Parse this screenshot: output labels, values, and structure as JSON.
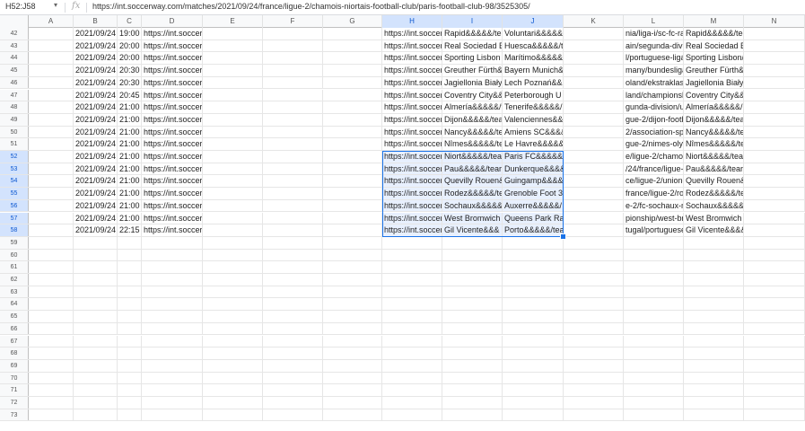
{
  "formula_bar": {
    "name_box": "H52:J58",
    "fx": "fx",
    "formula": "https://int.soccerway.com/matches/2021/09/24/france/ligue-2/chamois-niortais-football-club/paris-football-club-98/3525305/"
  },
  "columns": [
    "A",
    "B",
    "C",
    "D",
    "E",
    "F",
    "G",
    "H",
    "I",
    "J",
    "K",
    "L",
    "M",
    "N"
  ],
  "selected_columns": [
    "H",
    "I",
    "J"
  ],
  "selected_rows": [
    52,
    53,
    54,
    55,
    56,
    57,
    58
  ],
  "rows": [
    {
      "n": 42,
      "B": "2021/09/24",
      "C": "19:00",
      "D": "https://int.soccer",
      "H": "https://int.soccer",
      "I": "Rapid&&&&&/te",
      "J": "Voluntari&&&&&",
      "L": "nia/liga-i/sc-fc-rap",
      "M": "Rapid&&&&&/teomania/cs-fc-petr"
    },
    {
      "n": 43,
      "B": "2021/09/24",
      "C": "20:00",
      "D": "https://int.soccer",
      "H": "https://int.soccer",
      "I": "Real Sociedad E",
      "J": "Huesca&&&&&/t",
      "L": "ain/segunda-divis",
      "M": "Real Sociedad E/teams/spain/sd"
    },
    {
      "n": 44,
      "B": "2021/09/24",
      "C": "20:00",
      "D": "https://int.soccer",
      "H": "https://int.soccer",
      "I": "Sporting Lisbon",
      "J": "Marítimo&&&&&",
      "L": "l/portuguese-liga",
      "M": "Sporting Lisbon/ams/portugal/ma"
    },
    {
      "n": 45,
      "B": "2021/09/24",
      "C": "20:30",
      "D": "https://int.soccer",
      "H": "https://int.soccer",
      "I": "Greuther Fürth&",
      "J": "Bayern Munich&",
      "L": "many/bundesliga",
      "M": "Greuther Fürth&/teams/germany/f"
    },
    {
      "n": 46,
      "B": "2021/09/24",
      "C": "20:30",
      "D": "https://int.soccer",
      "H": "https://int.soccer",
      "I": "Jagiellonia Biały",
      "J": "Lech Poznań&&",
      "L": "oland/ekstraklas",
      "M": "Jagiellonia Biały/teams/poland/k"
    },
    {
      "n": 47,
      "B": "2021/09/24",
      "C": "20:45",
      "D": "https://int.soccer",
      "H": "https://int.soccer",
      "I": "Coventry City&&",
      "J": "Peterborough U",
      "L": "land/championsh",
      "M": "Coventry City&&/teams/england/"
    },
    {
      "n": 48,
      "B": "2021/09/24",
      "C": "21:00",
      "D": "https://int.soccer",
      "H": "https://int.soccer",
      "I": "Almería&&&&&/t",
      "J": "Tenerife&&&&&/",
      "L": "gunda-division/u",
      "M": "Almería&&&&&/ns/spain/club-dep"
    },
    {
      "n": 49,
      "B": "2021/09/24",
      "C": "21:00",
      "D": "https://int.soccer",
      "H": "https://int.soccer",
      "I": "Dijon&&&&&/tea",
      "J": "Valenciennes&&",
      "L": "gue-2/dijon-footb",
      "M": "Dijon&&&&&/tea/france/valencien"
    },
    {
      "n": 50,
      "B": "2021/09/24",
      "C": "21:00",
      "D": "https://int.soccer",
      "H": "https://int.soccer",
      "I": "Nancy&&&&&/te",
      "J": "Amiens SC&&&&",
      "L": "2/association-spc",
      "M": "Nancy&&&&&/te/france/amiens-s"
    },
    {
      "n": 51,
      "B": "2021/09/24",
      "C": "21:00",
      "D": "https://int.soccer",
      "H": "https://int.soccer",
      "I": "Nîmes&&&&&/te",
      "J": "Le Havre&&&&&",
      "L": "gue-2/nimes-olyn",
      "M": "Nîmes&&&&&/te/e/le-havre-athlet"
    },
    {
      "n": 52,
      "B": "2021/09/24",
      "C": "21:00",
      "D": "https://int.soccer",
      "H": "https://int.soccer",
      "I": "Niort&&&&&/tea",
      "J": "Paris FC&&&&&",
      "L": "e/ligue-2/chamois",
      "M": "Niort&&&&&/teams/france/paris-fc"
    },
    {
      "n": 53,
      "B": "2021/09/24",
      "C": "21:00",
      "D": "https://int.soccer",
      "H": "https://int.soccer",
      "I": "Pau&&&&&/tear",
      "J": "Dunkerque&&&&",
      "L": "/24/france/ligue-2",
      "M": "Pau&&&&&/tear/teams/france/us"
    },
    {
      "n": 54,
      "B": "2021/09/24",
      "C": "21:00",
      "D": "https://int.soccer",
      "H": "https://int.soccer",
      "I": "Quevilly Rouen&",
      "J": "Guingamp&&&&",
      "L": "ce/ligue-2/union-s",
      "M": "Quevilly Rouen&ms/france/en-ava"
    },
    {
      "n": 55,
      "B": "2021/09/24",
      "C": "21:00",
      "D": "https://int.soccer",
      "H": "https://int.soccer",
      "I": "Rodez&&&&&/te",
      "J": "Grenoble Foot 3",
      "L": "france/ligue-2/roc",
      "M": "Rodez&&&&&/te&/teams/france"
    },
    {
      "n": 56,
      "B": "2021/09/24",
      "C": "21:00",
      "D": "https://int.soccer",
      "H": "https://int.soccer",
      "I": "Sochaux&&&&&",
      "J": "Auxerre&&&&&/",
      "L": "e-2/fc-sochaux-m",
      "M": "Sochaux&&&&&/e/association-de-"
    },
    {
      "n": 57,
      "B": "2021/09/24",
      "C": "21:00",
      "D": "https://int.soccer",
      "H": "https://int.soccer",
      "I": "West Bromwich",
      "J": "Queens Park Ra",
      "L": "pionship/west-br",
      "M": "West Bromwich &/teams/england"
    },
    {
      "n": 58,
      "B": "2021/09/24",
      "C": "22:15",
      "D": "https://int.soccer",
      "H": "https://int.soccer",
      "I": "Gil Vicente&&&",
      "J": "Porto&&&&&/tea",
      "L": "tugal/portuguese-",
      "M": "Gil Vicente&&&&portugal/futebol-c"
    },
    {
      "n": 59
    },
    {
      "n": 60
    },
    {
      "n": 61
    },
    {
      "n": 62
    },
    {
      "n": 63
    },
    {
      "n": 64
    },
    {
      "n": 65
    },
    {
      "n": 66
    },
    {
      "n": 67
    },
    {
      "n": 68
    },
    {
      "n": 69
    },
    {
      "n": 70
    },
    {
      "n": 71
    },
    {
      "n": 72
    },
    {
      "n": 73
    }
  ],
  "colors": {
    "selection_border": "#1a73e8",
    "selection_fill": "#e8f0fe",
    "header_bg": "#f8f9fa"
  }
}
